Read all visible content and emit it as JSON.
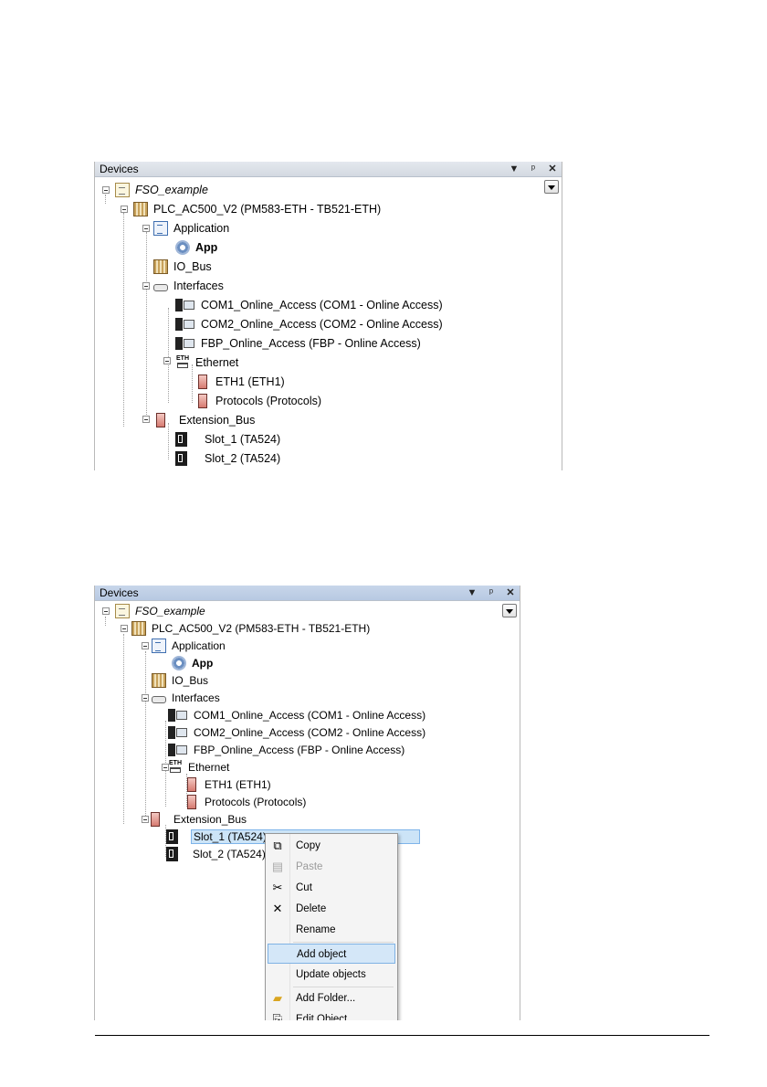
{
  "panel1": {
    "title": "Devices",
    "buttons": {
      "dropdown": "▾",
      "pin": "📌",
      "close": "✕"
    },
    "tree": [
      {
        "label": "FSO_example"
      },
      {
        "label": "PLC_AC500_V2 (PM583-ETH - TB521-ETH)"
      },
      {
        "label": "Application"
      },
      {
        "label": "App"
      },
      {
        "label": "IO_Bus"
      },
      {
        "label": "Interfaces"
      },
      {
        "label": "COM1_Online_Access (COM1 - Online Access)"
      },
      {
        "label": "COM2_Online_Access (COM2 - Online Access)"
      },
      {
        "label": "FBP_Online_Access (FBP - Online Access)"
      },
      {
        "label": "Ethernet"
      },
      {
        "label": "ETH1 (ETH1)"
      },
      {
        "label": "Protocols (Protocols)"
      },
      {
        "label": "Extension_Bus"
      },
      {
        "label": "Slot_1 (TA524)"
      },
      {
        "label": "Slot_2 (TA524)"
      }
    ]
  },
  "panel2": {
    "title": "Devices",
    "buttons": {
      "dropdown": "▾",
      "pin": "📌",
      "close": "✕"
    },
    "tree": [
      {
        "label": "FSO_example"
      },
      {
        "label": "PLC_AC500_V2 (PM583-ETH - TB521-ETH)"
      },
      {
        "label": "Application"
      },
      {
        "label": "App"
      },
      {
        "label": "IO_Bus"
      },
      {
        "label": "Interfaces"
      },
      {
        "label": "COM1_Online_Access (COM1 - Online Access)"
      },
      {
        "label": "COM2_Online_Access (COM2 - Online Access)"
      },
      {
        "label": "FBP_Online_Access (FBP - Online Access)"
      },
      {
        "label": "Ethernet"
      },
      {
        "label": "ETH1 (ETH1)"
      },
      {
        "label": "Protocols (Protocols)"
      },
      {
        "label": "Extension_Bus"
      },
      {
        "label": "Slot_1 (TA524)"
      },
      {
        "label": "Slot_2 (TA524)"
      }
    ],
    "eth_icon_text": "ETH",
    "context_menu": [
      {
        "label": "Copy",
        "icon": "copy-icon",
        "enabled": true
      },
      {
        "label": "Paste",
        "icon": "paste-icon",
        "enabled": false
      },
      {
        "label": "Cut",
        "icon": "scissors-icon",
        "enabled": true
      },
      {
        "label": "Delete",
        "icon": "delete-x-icon",
        "enabled": true
      },
      {
        "label": "Rename",
        "icon": "",
        "enabled": true
      },
      {
        "label": "Add object",
        "icon": "",
        "enabled": true,
        "highlighted": true
      },
      {
        "label": "Update objects",
        "icon": "",
        "enabled": true
      },
      {
        "label": "Add Folder...",
        "icon": "folder-icon",
        "enabled": true
      },
      {
        "label": "Edit Object",
        "icon": "edit-object-icon",
        "enabled": true
      }
    ]
  },
  "colors": {
    "selection_fill": "#cce4f7",
    "selection_border": "#7eb4ea",
    "menu_highlight": "#d4e7f8"
  }
}
